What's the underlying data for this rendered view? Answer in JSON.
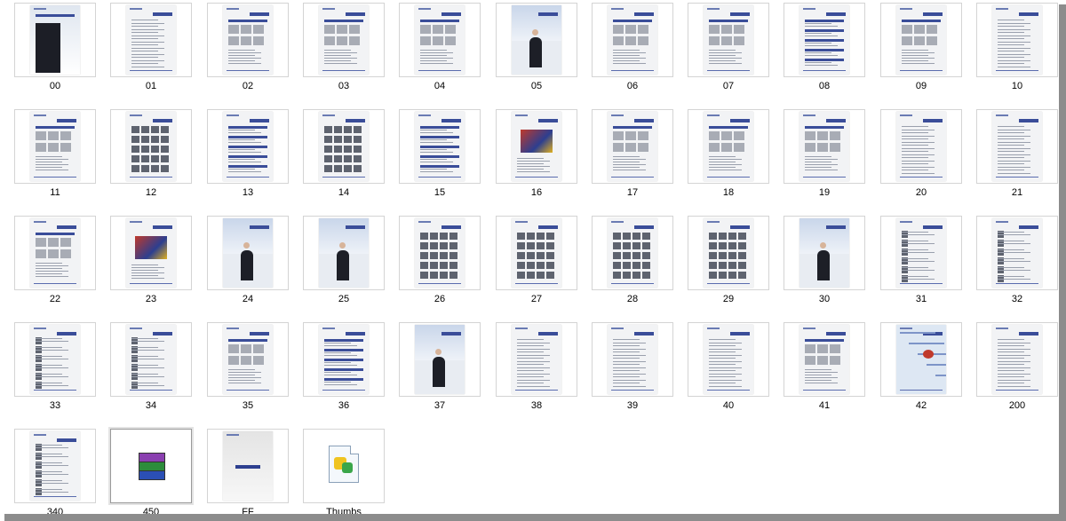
{
  "folder_view": {
    "items": [
      {
        "label": "00",
        "kind": "cover"
      },
      {
        "label": "01",
        "kind": "text"
      },
      {
        "label": "02",
        "kind": "figure"
      },
      {
        "label": "03",
        "kind": "figure"
      },
      {
        "label": "04",
        "kind": "figure"
      },
      {
        "label": "05",
        "kind": "photo"
      },
      {
        "label": "06",
        "kind": "figure"
      },
      {
        "label": "07",
        "kind": "figure"
      },
      {
        "label": "08",
        "kind": "list"
      },
      {
        "label": "09",
        "kind": "figure"
      },
      {
        "label": "10",
        "kind": "text"
      },
      {
        "label": "11",
        "kind": "figure"
      },
      {
        "label": "12",
        "kind": "gallery"
      },
      {
        "label": "13",
        "kind": "list"
      },
      {
        "label": "14",
        "kind": "gallery"
      },
      {
        "label": "15",
        "kind": "list"
      },
      {
        "label": "16",
        "kind": "chart"
      },
      {
        "label": "17",
        "kind": "figure"
      },
      {
        "label": "18",
        "kind": "figure"
      },
      {
        "label": "19",
        "kind": "figure"
      },
      {
        "label": "20",
        "kind": "text"
      },
      {
        "label": "21",
        "kind": "text"
      },
      {
        "label": "22",
        "kind": "figure"
      },
      {
        "label": "23",
        "kind": "chart"
      },
      {
        "label": "24",
        "kind": "photo"
      },
      {
        "label": "25",
        "kind": "photo"
      },
      {
        "label": "26",
        "kind": "gallery"
      },
      {
        "label": "27",
        "kind": "gallery"
      },
      {
        "label": "28",
        "kind": "gallery"
      },
      {
        "label": "29",
        "kind": "gallery"
      },
      {
        "label": "30",
        "kind": "photo"
      },
      {
        "label": "31",
        "kind": "people"
      },
      {
        "label": "32",
        "kind": "people"
      },
      {
        "label": "33",
        "kind": "people"
      },
      {
        "label": "34",
        "kind": "people"
      },
      {
        "label": "35",
        "kind": "figure"
      },
      {
        "label": "36",
        "kind": "list"
      },
      {
        "label": "37",
        "kind": "photo"
      },
      {
        "label": "38",
        "kind": "text"
      },
      {
        "label": "39",
        "kind": "text"
      },
      {
        "label": "40",
        "kind": "text"
      },
      {
        "label": "41",
        "kind": "figure"
      },
      {
        "label": "42",
        "kind": "map"
      },
      {
        "label": "200",
        "kind": "text"
      },
      {
        "label": "340",
        "kind": "people"
      },
      {
        "label": "450",
        "kind": "archive",
        "selected": true
      },
      {
        "label": "FF",
        "kind": "logo"
      },
      {
        "label": "Thumbs",
        "kind": "file"
      }
    ]
  }
}
